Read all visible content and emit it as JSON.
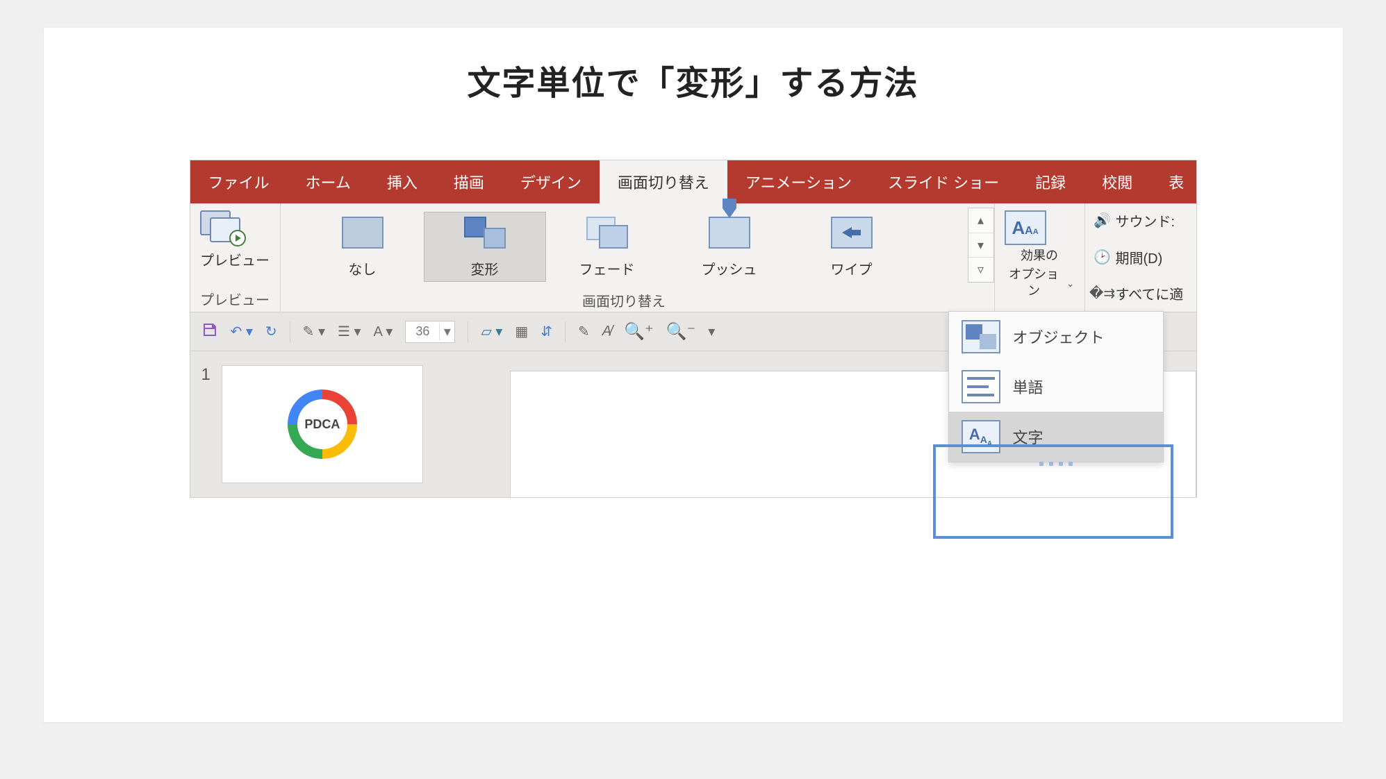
{
  "page_title": "文字単位で「変形」する方法",
  "tabs": {
    "file": "ファイル",
    "home": "ホーム",
    "insert": "挿入",
    "draw": "描画",
    "design": "デザイン",
    "transitions": "画面切り替え",
    "animations": "アニメーション",
    "slideshow": "スライド ショー",
    "record": "記録",
    "review": "校閲",
    "view": "表"
  },
  "ribbon": {
    "preview_btn": "プレビュー",
    "preview_group": "プレビュー",
    "gallery": {
      "none": "なし",
      "morph": "変形",
      "fade": "フェード",
      "push": "プッシュ",
      "wipe": "ワイプ",
      "group_label": "画面切り替え"
    },
    "effect_options": {
      "line1": "効果の",
      "line2": "オプション"
    },
    "timing": {
      "sound": "サウンド:",
      "duration": "期間(D)",
      "apply_all": "すべてに適"
    }
  },
  "qat": {
    "font_size": "36"
  },
  "slide": {
    "number": "1",
    "thumb_label": "PDCA"
  },
  "dropdown": {
    "object": "オブジェクト",
    "word": "単語",
    "char": "文字"
  }
}
